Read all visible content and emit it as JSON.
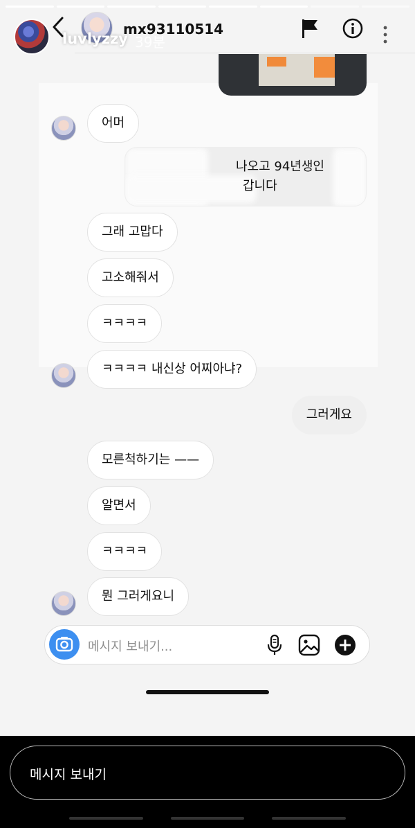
{
  "story": {
    "username": "luvlyzzy",
    "time": "39분",
    "progress_segments": 8,
    "progress_done": 6,
    "reply_placeholder": "메시지 보내기"
  },
  "dm": {
    "header": {
      "username": "mx93110514"
    },
    "messages": [
      {
        "id": "m1",
        "side": "in",
        "text": "어머",
        "avatar": true
      },
      {
        "id": "m2",
        "side": "in",
        "text": "나오고 94년생인",
        "text2": "갑니다",
        "redacted": true
      },
      {
        "id": "m3",
        "side": "in",
        "text": "그래   고맙다"
      },
      {
        "id": "m4",
        "side": "in",
        "text": "고소해줘서"
      },
      {
        "id": "m5",
        "side": "in",
        "text": "ㅋㅋㅋㅋ"
      },
      {
        "id": "m6",
        "side": "in",
        "text": "ㅋㅋㅋㅋ 내신상 어찌아냐?",
        "avatar": true
      },
      {
        "id": "m7",
        "side": "out",
        "text": "그러게요"
      },
      {
        "id": "m8",
        "side": "in",
        "text": "모른척하기는 ——"
      },
      {
        "id": "m9",
        "side": "in",
        "text": "알면서"
      },
      {
        "id": "m10",
        "side": "in",
        "text": "ㅋㅋㅋㅋ"
      },
      {
        "id": "m11",
        "side": "in",
        "text": "뭔 그러게요니",
        "avatar": true
      }
    ],
    "composer": {
      "placeholder": "메시지 보내기..."
    }
  },
  "colors": {
    "accent": "#3d8ff0",
    "bubble_out": "#efefef",
    "bubble_in_border": "#e2e2e2",
    "media_tape": "#f08a3a"
  },
  "icons": [
    "back-icon",
    "flag-icon",
    "info-icon",
    "more-icon",
    "camera-icon",
    "mic-icon",
    "gallery-icon",
    "plus-icon"
  ]
}
